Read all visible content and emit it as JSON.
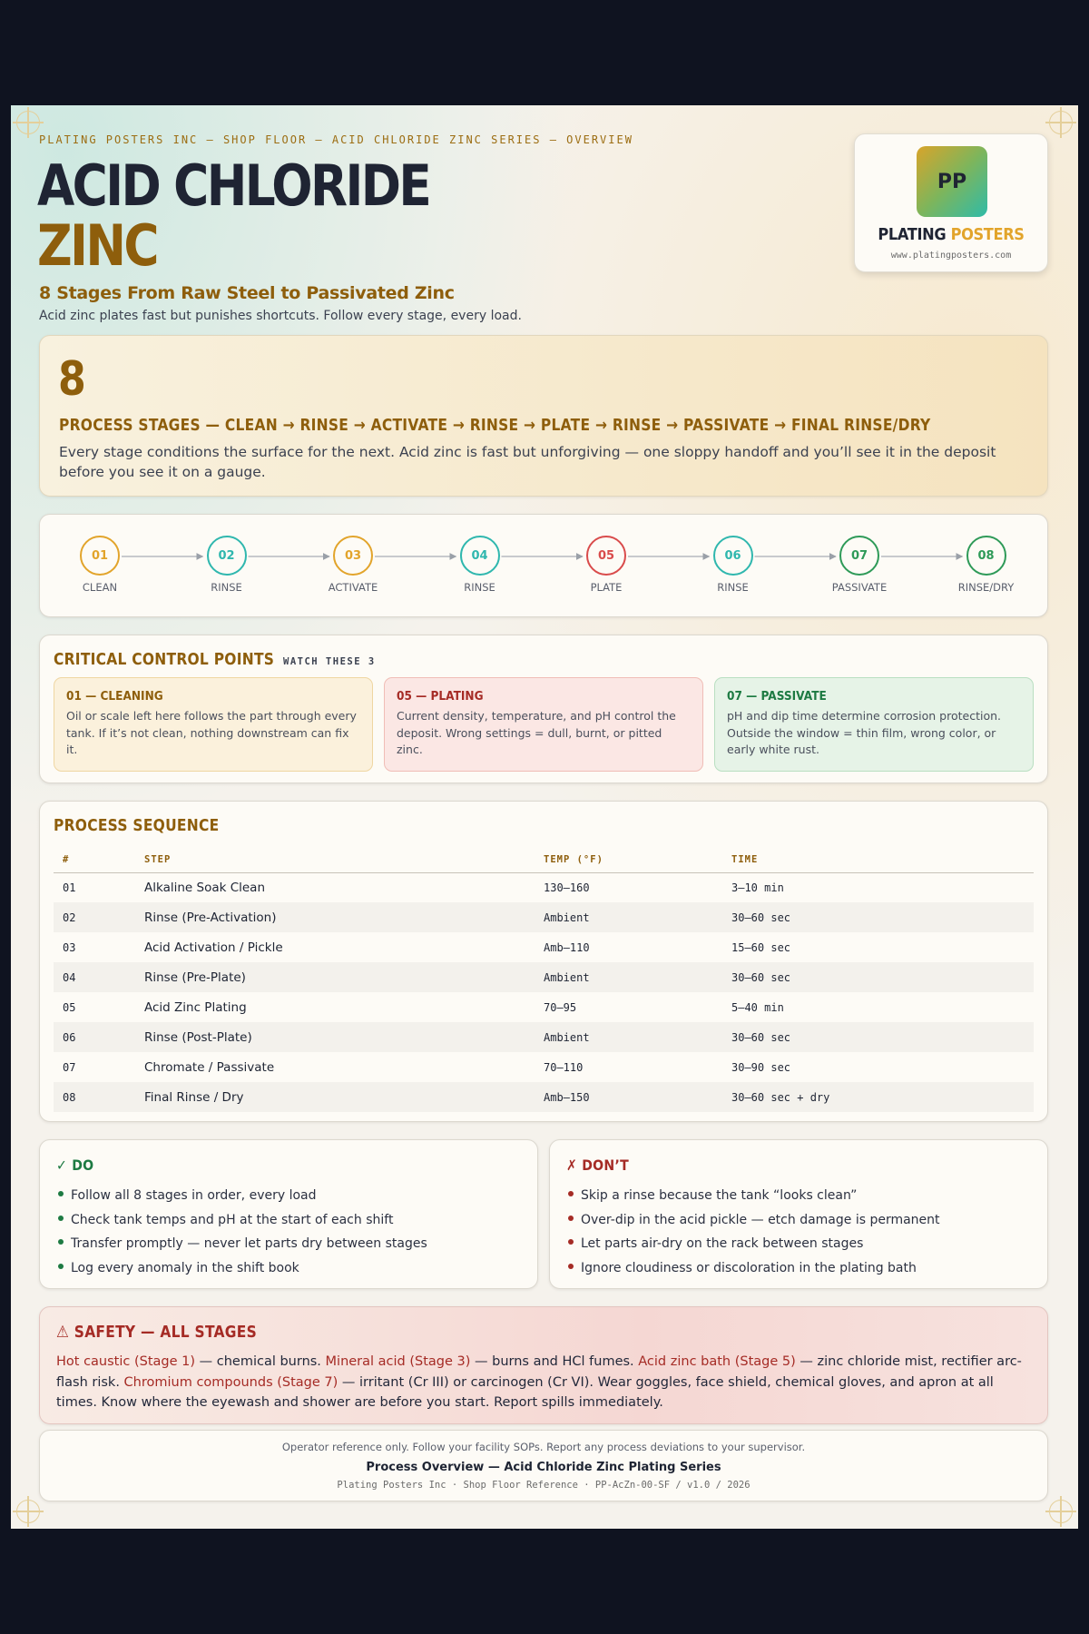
{
  "header": {
    "kicker": "PLATING POSTERS INC — SHOP FLOOR — ACID CHLORIDE ZINC SERIES — OVERVIEW",
    "title_line1": "ACID CHLORIDE",
    "title_line2": "ZINC",
    "subtitle": "8 Stages From Raw Steel to Passivated Zinc",
    "tagline": "Acid zinc plates fast but punishes shortcuts. Follow every stage, every load."
  },
  "brand": {
    "logo_text": "PP",
    "name_part1": "PLATING",
    "name_part2": "POSTERS",
    "url": "www.platingposters.com"
  },
  "hero": {
    "number": "8",
    "heading": "PROCESS STAGES — CLEAN → RINSE → ACTIVATE → RINSE → PLATE → RINSE → PASSIVATE → FINAL RINSE/DRY",
    "text": "Every stage conditions the surface for the next. Acid zinc is fast but unforgiving — one sloppy handoff and you’ll see it in the deposit before you see it on a gauge."
  },
  "flow": {
    "stages": [
      {
        "num": "01",
        "label": "CLEAN",
        "color": "#e2a42b"
      },
      {
        "num": "02",
        "label": "RINSE",
        "color": "#2fb7ae"
      },
      {
        "num": "03",
        "label": "ACTIVATE",
        "color": "#e2a42b"
      },
      {
        "num": "04",
        "label": "RINSE",
        "color": "#2fb7ae"
      },
      {
        "num": "05",
        "label": "PLATE",
        "color": "#d94b4b"
      },
      {
        "num": "06",
        "label": "RINSE",
        "color": "#2fb7ae"
      },
      {
        "num": "07",
        "label": "PASSIVATE",
        "color": "#2e9a58"
      },
      {
        "num": "08",
        "label": "RINSE/DRY",
        "color": "#2e9a58"
      }
    ]
  },
  "ccp": {
    "title": "CRITICAL CONTROL POINTS",
    "subtitle": "WATCH THESE 3",
    "items": [
      {
        "title": "01 — CLEANING",
        "text": "Oil or scale left here follows the part through every tank. If it’s not clean, nothing downstream can fix it.",
        "color": "#8e5e0c",
        "bg": "#fbf1dc",
        "border": "#efd6a2"
      },
      {
        "title": "05 — PLATING",
        "text": "Current density, temperature, and pH control the deposit. Wrong settings = dull, burnt, or pitted zinc.",
        "color": "#a52b25",
        "bg": "#fbe7e4",
        "border": "#f0bdb6"
      },
      {
        "title": "07 — PASSIVATE",
        "text": "pH and dip time determine corrosion protection. Outside the window = thin film, wrong color, or early white rust.",
        "color": "#1d7a42",
        "bg": "#e6f3e7",
        "border": "#b9dfc1"
      }
    ]
  },
  "sequence": {
    "title": "PROCESS SEQUENCE",
    "columns": [
      "#",
      "STEP",
      "TEMP (°F)",
      "TIME"
    ],
    "rows": [
      [
        "01",
        "Alkaline Soak Clean",
        "130–160",
        "3–10 min"
      ],
      [
        "02",
        "Rinse (Pre-Activation)",
        "Ambient",
        "30–60 sec"
      ],
      [
        "03",
        "Acid Activation / Pickle",
        "Amb–110",
        "15–60 sec"
      ],
      [
        "04",
        "Rinse (Pre-Plate)",
        "Ambient",
        "30–60 sec"
      ],
      [
        "05",
        "Acid Zinc Plating",
        "70–95",
        "5–40 min"
      ],
      [
        "06",
        "Rinse (Post-Plate)",
        "Ambient",
        "30–60 sec"
      ],
      [
        "07",
        "Chromate / Passivate",
        "70–110",
        "30–90 sec"
      ],
      [
        "08",
        "Final Rinse / Dry",
        "Amb–150",
        "30–60 sec + dry"
      ]
    ]
  },
  "do_list": {
    "title": "✓ DO",
    "color": "#1d7a42",
    "items": [
      "Follow all 8 stages in order, every load",
      "Check tank temps and pH at the start of each shift",
      "Transfer promptly — never let parts dry between stages",
      "Log every anomaly in the shift book"
    ]
  },
  "dont_list": {
    "title": "✗ DON’T",
    "color": "#a52b25",
    "items": [
      "Skip a rinse because the tank “looks clean”",
      "Over-dip in the acid pickle — etch damage is permanent",
      "Let parts air-dry on the rack between stages",
      "Ignore cloudiness or discoloration in the plating bath"
    ]
  },
  "safety": {
    "title": "⚠ SAFETY — ALL STAGES",
    "hl1": "Hot caustic (Stage 1)",
    "t1": " — chemical burns. ",
    "hl2": "Mineral acid (Stage 3)",
    "t2": " — burns and HCl fumes. ",
    "hl3": "Acid zinc bath (Stage 5)",
    "t3": " — zinc chloride mist, rectifier arc-flash risk. ",
    "hl4": "Chromium compounds (Stage 7)",
    "t4": " — irritant (Cr III) or carcinogen (Cr VI). Wear goggles, face shield, chemical gloves, and apron at all times. Know where the eyewash and shower are before you start. Report spills immediately."
  },
  "footer": {
    "note": "Operator reference only. Follow your facility SOPs. Report any process deviations to your supervisor.",
    "title": "Process Overview — Acid Chloride Zinc Plating Series",
    "meta": "Plating Posters Inc · Shop Floor Reference · PP-AcZn-00-SF / v1.0 / 2026"
  }
}
